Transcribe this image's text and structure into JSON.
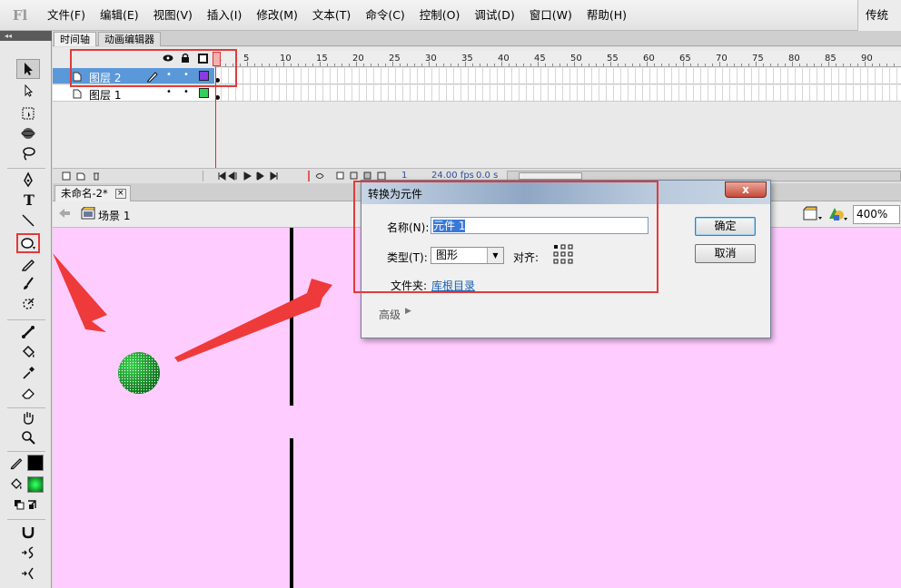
{
  "app": {
    "logo": "Fl",
    "workspace": "传统"
  },
  "menu": [
    "文件(F)",
    "编辑(E)",
    "视图(V)",
    "插入(I)",
    "修改(M)",
    "文本(T)",
    "命令(C)",
    "控制(O)",
    "调试(D)",
    "窗口(W)",
    "帮助(H)"
  ],
  "toolbar": {
    "collapse_glyph": "◂◂"
  },
  "timeline_tabs": [
    "时间轴",
    "动画编辑器"
  ],
  "timeline": {
    "ruler_labels": [
      "1",
      "5",
      "10",
      "15",
      "20",
      "25",
      "30",
      "35",
      "40",
      "45",
      "50",
      "55",
      "60",
      "65",
      "70",
      "75",
      "80",
      "85",
      "90"
    ],
    "layers": [
      {
        "name": "图层 2",
        "color": "#8b3be0",
        "selected": true
      },
      {
        "name": "图层 1",
        "color": "#33d05a",
        "selected": false
      }
    ],
    "status": {
      "frame": "1",
      "fps": "24.00 fps",
      "time": "0.0 s"
    }
  },
  "document": {
    "tab": "未命名-2*",
    "scene": "场景 1",
    "zoom": "400%"
  },
  "stage": {
    "background": "#ffccff",
    "ball_color": "#1a9e2a"
  },
  "dialog": {
    "title": "转换为元件",
    "name_label": "名称(N):",
    "name_value": "元件 1",
    "type_label": "类型(T):",
    "type_value": "图形",
    "align_label": "对齐:",
    "folder_label": "文件夹:",
    "folder_value": "库根目录",
    "advanced_label": "高级",
    "ok_label": "确定",
    "cancel_label": "取消",
    "close_glyph": "x"
  }
}
